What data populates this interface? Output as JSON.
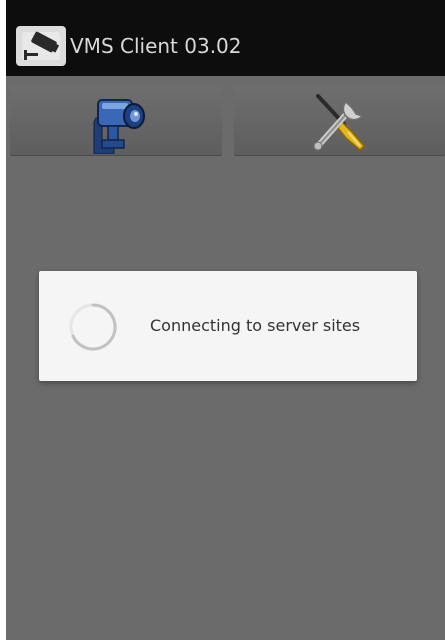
{
  "app": {
    "title": "VMS Client 03.02"
  },
  "toolbar": {
    "camera_icon": "security-camera-icon",
    "settings_icon": "wrench-screwdriver-icon"
  },
  "dialog": {
    "message": "Connecting to server sites",
    "spinner_icon": "loading-spinner-icon"
  },
  "colors": {
    "action_bar": "#0d0d0d",
    "background": "#6b6b6b",
    "dialog": "#f5f5f5"
  }
}
